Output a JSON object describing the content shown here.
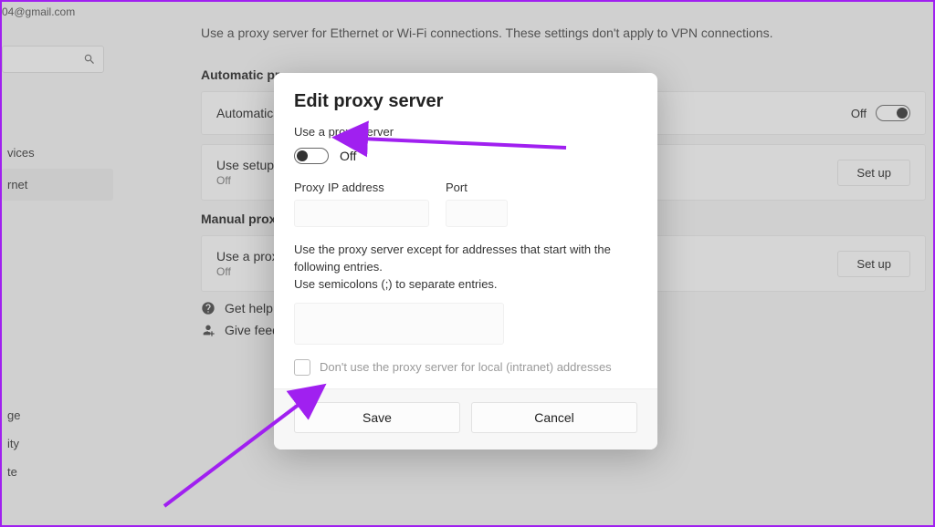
{
  "header": {
    "email": "04@gmail.com"
  },
  "nav": {
    "item1": "vices",
    "item2": "rnet",
    "bottom1": "ge",
    "bottom2": "ity",
    "bottom3": "te"
  },
  "page": {
    "description": "Use a proxy server for Ethernet or Wi-Fi connections. These settings don't apply to VPN connections.",
    "auto_header": "Automatic pr",
    "auto_row1": "Automatica",
    "auto_row1_state": "Off",
    "auto_row2_title": "Use setup s",
    "auto_row2_sub": "Off",
    "setup_btn": "Set up",
    "manual_header": "Manual proxy",
    "manual_row_title": "Use a proxy",
    "manual_row_sub": "Off",
    "help": "Get help",
    "feedback": "Give feed"
  },
  "dialog": {
    "title": "Edit proxy server",
    "use_label": "Use a proxy server",
    "toggle_state": "Off",
    "ip_label": "Proxy IP address",
    "port_label": "Port",
    "exc_line1": "Use the proxy server except for addresses that start with the following entries.",
    "exc_line2": "Use semicolons (;) to separate entries.",
    "chk_label": "Don't use the proxy server for local (intranet) addresses",
    "save": "Save",
    "cancel": "Cancel"
  }
}
